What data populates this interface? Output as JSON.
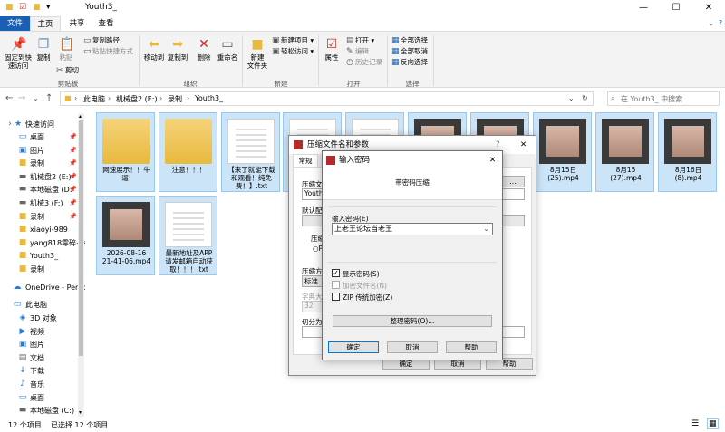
{
  "window": {
    "title": "Youth3_",
    "minimize": "—",
    "maximize": "☐",
    "close": "✕"
  },
  "tabs": {
    "file": "文件",
    "home": "主页",
    "share": "共享",
    "view": "查看"
  },
  "ribbon": {
    "clipboard": {
      "pin": "固定到快\n速访问",
      "copy": "复制",
      "paste": "粘贴",
      "copy_path": "复制路径",
      "paste_shortcut": "粘贴快捷方式",
      "cut": "剪切",
      "label": "剪贴板"
    },
    "organize": {
      "move_to": "移动到",
      "copy_to": "复制到",
      "delete": "删除",
      "rename": "重命名",
      "label": "组织"
    },
    "new": {
      "new_folder": "新建\n文件夹",
      "new_item": "新建项目 ▾",
      "easy_access": "轻松访问 ▾",
      "label": "新建"
    },
    "open": {
      "properties": "属性",
      "open": "打开 ▾",
      "edit": "编辑",
      "history": "历史记录",
      "label": "打开"
    },
    "select": {
      "select_all": "全部选择",
      "select_none": "全部取消",
      "invert": "反向选择",
      "label": "选择"
    }
  },
  "address": {
    "crumbs": [
      "此电脑",
      "机械盘2 (E:)",
      "录制",
      "Youth3_"
    ],
    "search_placeholder": "在 Youth3_ 中搜索"
  },
  "nav": {
    "quick_access": "快速访问",
    "items": [
      {
        "label": "桌面",
        "icon": "desktop-icon",
        "pinned": true
      },
      {
        "label": "图片",
        "icon": "pictures-icon",
        "pinned": true
      },
      {
        "label": "录制",
        "icon": "folder-icon",
        "pinned": true
      },
      {
        "label": "机械盘2 (E:)",
        "icon": "drive-icon",
        "pinned": true
      },
      {
        "label": "本地磁盘 (D:",
        "icon": "drive-icon",
        "pinned": true
      },
      {
        "label": "机械3 (F:)",
        "icon": "drive-icon",
        "pinned": true
      },
      {
        "label": "录制",
        "icon": "folder-icon",
        "pinned": true
      },
      {
        "label": "xiaoyi-989",
        "icon": "folder-icon",
        "pinned": false
      },
      {
        "label": "yang818零碎+a",
        "icon": "folder-icon",
        "pinned": false
      },
      {
        "label": "Youth3_",
        "icon": "folder-icon",
        "pinned": false
      },
      {
        "label": "录制",
        "icon": "folder-icon",
        "pinned": false
      }
    ],
    "onedrive": "OneDrive - Perso",
    "this_pc": "此电脑",
    "pc_items": [
      {
        "label": "3D 对象",
        "icon": "3d-objects-icon"
      },
      {
        "label": "视频",
        "icon": "videos-icon"
      },
      {
        "label": "图片",
        "icon": "pictures-icon"
      },
      {
        "label": "文档",
        "icon": "documents-icon"
      },
      {
        "label": "下载",
        "icon": "downloads-icon"
      },
      {
        "label": "音乐",
        "icon": "music-icon"
      },
      {
        "label": "桌面",
        "icon": "desktop-icon"
      },
      {
        "label": "本地磁盘 (C:)",
        "icon": "drive-icon"
      }
    ]
  },
  "files": [
    {
      "name": "网速展示！！牛\n逼!",
      "kind": "folder"
    },
    {
      "name": "注意！！！",
      "kind": "folder"
    },
    {
      "name": "【来了就能下载\n和观看！纯免\n费！】.txt",
      "kind": "text"
    },
    {
      "name": "",
      "kind": "text"
    },
    {
      "name": "",
      "kind": "text"
    },
    {
      "name": "",
      "kind": "video"
    },
    {
      "name": "",
      "kind": "video"
    },
    {
      "name": "8月15日\n(25).mp4",
      "kind": "video"
    },
    {
      "name": "8月15\n(27).mp4",
      "kind": "video"
    },
    {
      "name": "8月16日\n(8).mp4",
      "kind": "video"
    },
    {
      "name": "2026-08-16\n21-41-06.mp4",
      "kind": "video"
    },
    {
      "name": "最新地址及APP\n请发邮箱自动获\n取！！！.txt",
      "kind": "text"
    }
  ],
  "status": {
    "count": "12 个项目",
    "selected": "已选择 12 个项目"
  },
  "archive_dialog": {
    "title": "压缩文件名和参数",
    "help": "?",
    "close": "✕",
    "tab_general": "常规",
    "field_labels": [
      "压缩文",
      "Youth3",
      "默认配",
      "压缩",
      "○P",
      "压缩方",
      "标准",
      "字典大",
      "32",
      "切分为"
    ],
    "ok": "确定",
    "cancel": "取消",
    "help_btn": "帮助"
  },
  "password_dialog": {
    "title": "输入密码",
    "close": "✕",
    "subtitle": "带密码压缩",
    "password_label": "输入密码(E)",
    "password_value": "上老王论坛当老王",
    "show_password": "显示密码(S)",
    "show_password_checked": true,
    "encrypt_names": "加密文件名(N)",
    "encrypt_names_checked": false,
    "zip_legacy": "ZIP 传统加密(Z)",
    "zip_legacy_checked": false,
    "organize": "整理密码(O)...",
    "ok": "确定",
    "cancel": "取消",
    "help": "帮助"
  }
}
